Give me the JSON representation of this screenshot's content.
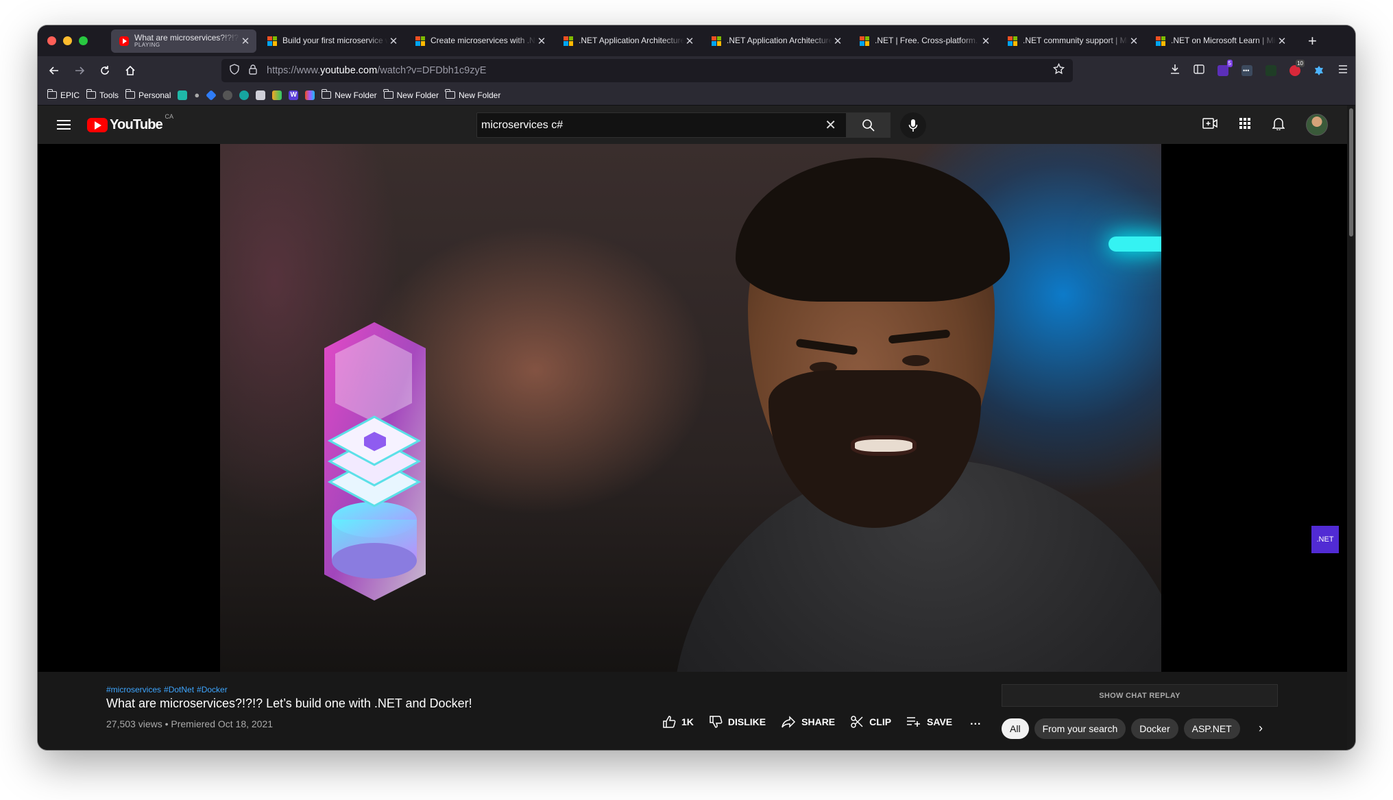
{
  "browser": {
    "tabs": [
      {
        "title": "What are microservices?!?!? Let's build one",
        "subtitle": "PLAYING",
        "favicon": "youtube-icon",
        "active": true
      },
      {
        "title": "Build your first microservice with .NET",
        "favicon": "microsoft-icon"
      },
      {
        "title": "Create microservices with .NET",
        "favicon": "microsoft-icon"
      },
      {
        "title": ".NET Application Architecture Guides",
        "favicon": "microsoft-icon"
      },
      {
        "title": ".NET Application Architecture Guides",
        "favicon": "microsoft-icon"
      },
      {
        "title": ".NET | Free. Cross-platform. Open Source.",
        "favicon": "microsoft-icon"
      },
      {
        "title": ".NET community support | Microsoft",
        "favicon": "microsoft-icon"
      },
      {
        "title": ".NET on Microsoft Learn | Microsoft",
        "favicon": "microsoft-icon"
      }
    ],
    "url": {
      "prefix": "https://www.",
      "host": "youtube.com",
      "path": "/watch?v=DFDbh1c9zyE"
    },
    "extensions": {
      "badge_a": "5",
      "badge_b": "10"
    },
    "bookmarks": [
      {
        "label": "EPIC",
        "type": "folder"
      },
      {
        "label": "Tools",
        "type": "folder"
      },
      {
        "label": "Personal",
        "type": "folder"
      },
      {
        "label": "New Folder",
        "type": "folder"
      },
      {
        "label": "New Folder",
        "type": "folder"
      },
      {
        "label": "New Folder",
        "type": "folder"
      }
    ]
  },
  "youtube": {
    "logo_text": "YouTube",
    "country_code": "CA",
    "search_query": "microservices c#",
    "video": {
      "overlay_badge": ".NET",
      "hashtags": [
        "#microservices",
        "#DotNet",
        "#Docker"
      ],
      "title": "What are microservices?!?!? Let’s build one with .NET and Docker!",
      "meta": "27,503 views • Premiered Oct 18, 2021"
    },
    "actions": {
      "like": "1K",
      "dislike": "DISLIKE",
      "share": "SHARE",
      "clip": "CLIP",
      "save": "SAVE",
      "more": "..."
    },
    "chat_replay": "SHOW CHAT REPLAY",
    "chips": [
      "All",
      "From your search",
      "Docker",
      "ASP.NET"
    ]
  },
  "colors": {
    "brand_red": "#ff0000",
    "link_blue": "#3ea6ff",
    "dotnet_purple": "#512bd4"
  }
}
